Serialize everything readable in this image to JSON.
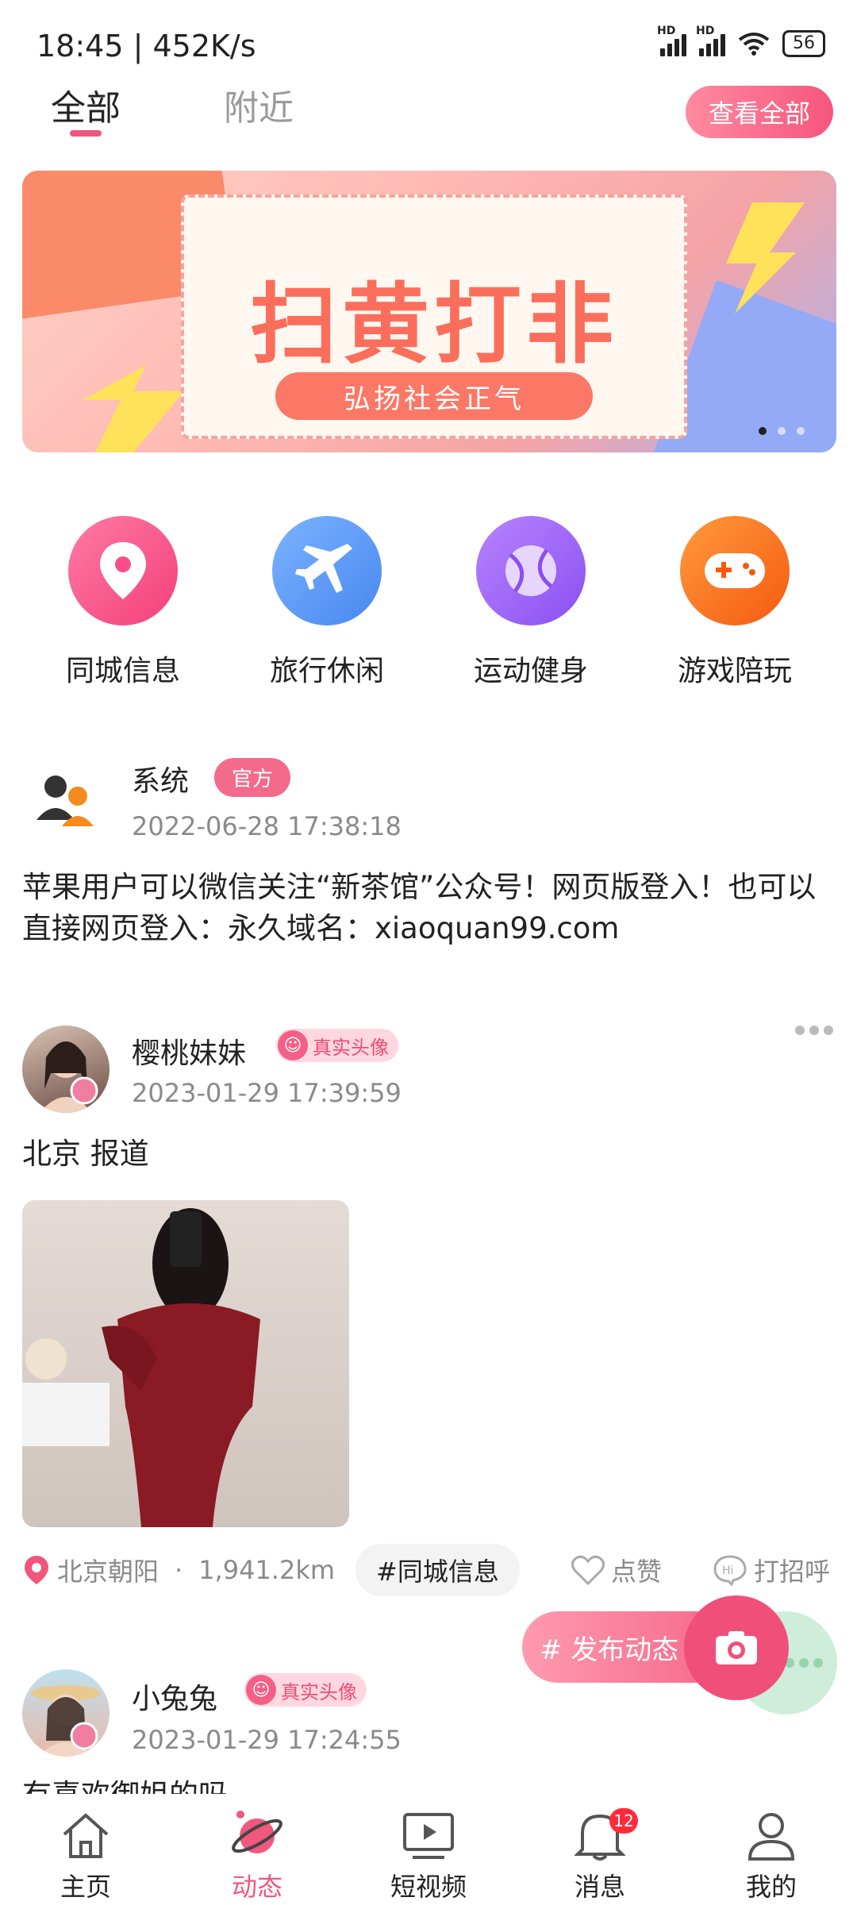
{
  "status_bar": {
    "time": "18:45 | 452K/s",
    "battery": "56"
  },
  "tabs": [
    {
      "label": "全部"
    },
    {
      "label": "附近"
    }
  ],
  "header": {
    "view_all": "查看全部"
  },
  "banner": {
    "title": "扫黄打非",
    "subtitle": "弘扬社会正气"
  },
  "categories": [
    {
      "label": "同城信息",
      "icon": "location-pin-icon",
      "color": "#f84f8a"
    },
    {
      "label": "旅行休闲",
      "icon": "airplane-icon",
      "color": "#5b9df5"
    },
    {
      "label": "运动健身",
      "icon": "ball-icon",
      "color": "#9b62f2"
    },
    {
      "label": "游戏陪玩",
      "icon": "gamepad-icon",
      "color": "#fb6b1f"
    }
  ],
  "posts": [
    {
      "username": "系统",
      "badge": "官方",
      "time": "2022-06-28 17:38:18",
      "text": "苹果用户可以微信关注“新茶馆”公众号！网页版登入！也可以直接网页登入：永久域名：xiaoquan99.com"
    },
    {
      "username": "樱桃妹妹",
      "badge": "真实头像",
      "time": "2023-01-29 17:39:59",
      "text": "北京 报道",
      "location": "北京朝阳",
      "distance": "1,941.2km",
      "tag": "#同城信息",
      "like_label": "点赞",
      "greet_label": "打招呼"
    },
    {
      "username": "小兔兔",
      "badge": "真实头像",
      "time": "2023-01-29 17:24:55",
      "text": "有喜欢御姐的吗"
    }
  ],
  "fab": {
    "publish_label": "# 发布动态"
  },
  "bottom_nav": [
    {
      "label": "主页",
      "icon": "home-icon"
    },
    {
      "label": "动态",
      "icon": "planet-icon",
      "active": true
    },
    {
      "label": "短视频",
      "icon": "video-icon"
    },
    {
      "label": "消息",
      "icon": "bell-icon",
      "badge": "12"
    },
    {
      "label": "我的",
      "icon": "profile-icon"
    }
  ],
  "colors": {
    "accent": "#f25b80"
  }
}
